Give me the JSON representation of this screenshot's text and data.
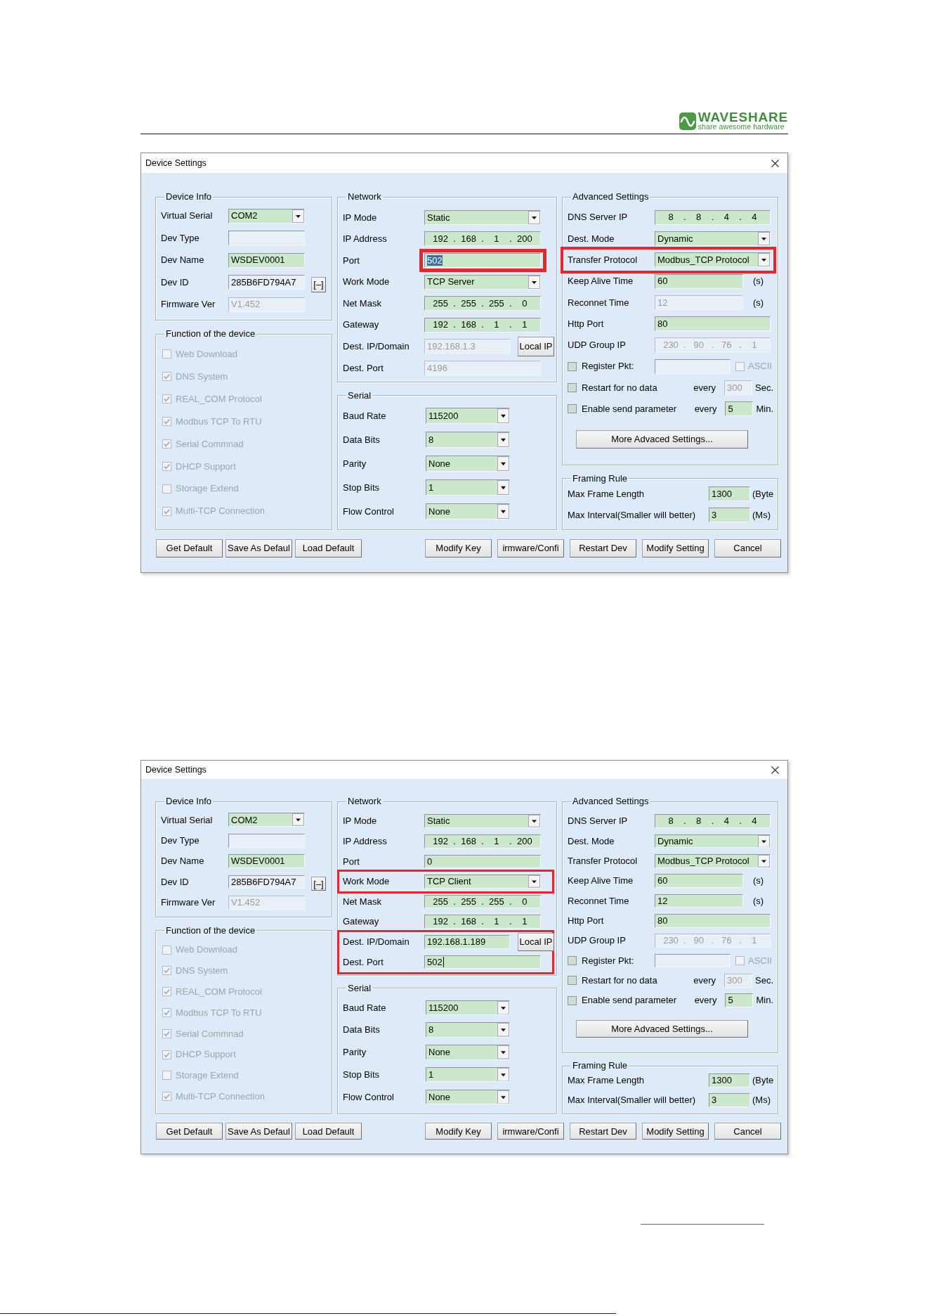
{
  "header": {
    "logo": {
      "name": "WAVESHARE",
      "tagline": "share awesome hardware"
    }
  },
  "dialogs": [
    {
      "title": "Device Settings",
      "columns": [
        {
          "groups": [
            {
              "title": "Device Info",
              "rows": [
                {
                  "kind": "field",
                  "label": "Virtual Serial",
                  "field": {
                    "kind": "combo",
                    "value": "COM2",
                    "editable": true,
                    "disabled": false
                  }
                },
                {
                  "kind": "field",
                  "label": "Dev Type",
                  "field": {
                    "kind": "text",
                    "editable": false,
                    "disabled": false
                  }
                },
                {
                  "kind": "field",
                  "label": "Dev Name",
                  "field": {
                    "kind": "text",
                    "value": "WSDEV0001",
                    "editable": true,
                    "disabled": false
                  }
                },
                {
                  "kind": "field",
                  "label": "Dev ID",
                  "field": {
                    "kind": "text",
                    "value": "285B6FD794A7",
                    "editable": false,
                    "disabled": false
                  },
                  "button": "[–]"
                },
                {
                  "kind": "field",
                  "label": "Firmware Ver",
                  "field": {
                    "kind": "text",
                    "value": "V1.452",
                    "editable": false,
                    "disabled": true
                  }
                }
              ]
            },
            {
              "title": "Function of the device",
              "rows": [
                {
                  "kind": "checkbox",
                  "label": "Web Download",
                  "checked": false,
                  "disabled": true
                },
                {
                  "kind": "checkbox",
                  "label": "DNS System",
                  "checked": true,
                  "disabled": true
                },
                {
                  "kind": "checkbox",
                  "label": "REAL_COM Protocol",
                  "checked": true,
                  "disabled": true
                },
                {
                  "kind": "checkbox",
                  "label": "Modbus TCP To RTU",
                  "checked": true,
                  "disabled": true
                },
                {
                  "kind": "checkbox",
                  "label": "Serial Commnad",
                  "checked": true,
                  "disabled": true
                },
                {
                  "kind": "checkbox",
                  "label": "DHCP Support",
                  "checked": true,
                  "disabled": true
                },
                {
                  "kind": "checkbox",
                  "label": "Storage Extend",
                  "checked": false,
                  "disabled": true
                },
                {
                  "kind": "checkbox",
                  "label": "Multi-TCP Connection",
                  "checked": true,
                  "disabled": true
                }
              ]
            }
          ]
        },
        {
          "groups": [
            {
              "title": "Network",
              "rows": [
                {
                  "kind": "field",
                  "label": "IP Mode",
                  "field": {
                    "kind": "combo",
                    "value": "Static",
                    "editable": true,
                    "disabled": false
                  }
                },
                {
                  "kind": "field",
                  "label": "IP Address",
                  "field": {
                    "kind": "ip",
                    "value": "192 . 168 . 1 . 200",
                    "editable": true,
                    "disabled": false
                  }
                },
                {
                  "kind": "field",
                  "label": "Port",
                  "field": {
                    "kind": "text",
                    "value": "502",
                    "editable": true,
                    "disabled": false,
                    "text_selected": true,
                    "highlighted": true
                  }
                },
                {
                  "kind": "field",
                  "label": "Work Mode",
                  "field": {
                    "kind": "combo",
                    "value": "TCP Server",
                    "editable": true,
                    "disabled": false
                  }
                },
                {
                  "kind": "field",
                  "label": "Net Mask",
                  "field": {
                    "kind": "ip",
                    "value": "255 . 255 . 255 . 0",
                    "editable": true,
                    "disabled": false
                  }
                },
                {
                  "kind": "field",
                  "label": "Gateway",
                  "field": {
                    "kind": "ip",
                    "value": "192 . 168 . 1 . 1",
                    "editable": true,
                    "disabled": false
                  }
                },
                {
                  "kind": "field",
                  "label": "Dest. IP/Domain",
                  "field": {
                    "kind": "text",
                    "value": "192.168.1.3",
                    "editable": false,
                    "disabled": true
                  },
                  "button": "Local IP"
                },
                {
                  "kind": "field",
                  "label": "Dest. Port",
                  "field": {
                    "kind": "text",
                    "value": "4196",
                    "editable": false,
                    "disabled": true
                  }
                }
              ]
            },
            {
              "title": "Serial",
              "rows": [
                {
                  "kind": "field",
                  "label": "Baud Rate",
                  "field": {
                    "kind": "combo",
                    "value": "115200",
                    "editable": true,
                    "disabled": false
                  }
                },
                {
                  "kind": "field",
                  "label": "Data Bits",
                  "field": {
                    "kind": "combo",
                    "value": "8",
                    "editable": true,
                    "disabled": false
                  }
                },
                {
                  "kind": "field",
                  "label": "Parity",
                  "field": {
                    "kind": "combo",
                    "value": "None",
                    "editable": true,
                    "disabled": false
                  }
                },
                {
                  "kind": "field",
                  "label": "Stop Bits",
                  "field": {
                    "kind": "combo",
                    "value": "1",
                    "editable": true,
                    "disabled": false
                  }
                },
                {
                  "kind": "field",
                  "label": "Flow Control",
                  "field": {
                    "kind": "combo",
                    "value": "None",
                    "editable": true,
                    "disabled": false
                  }
                }
              ]
            }
          ]
        },
        {
          "groups": [
            {
              "title": "Advanced Settings",
              "rows": [
                {
                  "kind": "field",
                  "label": "DNS Server IP",
                  "field": {
                    "kind": "ip",
                    "value": "8 . 8 . 4 . 4",
                    "editable": true,
                    "disabled": false
                  }
                },
                {
                  "kind": "field",
                  "label": "Dest. Mode",
                  "field": {
                    "kind": "combo",
                    "value": "Dynamic",
                    "editable": true,
                    "disabled": false
                  }
                },
                {
                  "kind": "field",
                  "label": "Transfer Protocol",
                  "field": {
                    "kind": "combo",
                    "value": "Modbus_TCP Protocol",
                    "editable": true,
                    "disabled": false
                  },
                  "highlighted": true
                },
                {
                  "kind": "field",
                  "label": "Keep Alive Time",
                  "field": {
                    "kind": "text",
                    "value": "60",
                    "editable": true,
                    "disabled": false
                  },
                  "unit": "(s)"
                },
                {
                  "kind": "field",
                  "label": "Reconnet Time",
                  "field": {
                    "kind": "text",
                    "value": "12",
                    "editable": false,
                    "disabled": true
                  },
                  "unit": "(s)"
                },
                {
                  "kind": "field",
                  "label": "Http Port",
                  "field": {
                    "kind": "text",
                    "value": "80",
                    "editable": true,
                    "disabled": false
                  }
                },
                {
                  "kind": "field",
                  "label": "UDP Group IP",
                  "field": {
                    "kind": "ip",
                    "value": "230 . 90 . 76 . 1",
                    "editable": false,
                    "disabled": true
                  }
                },
                {
                  "kind": "check_field",
                  "label": "Register Pkt:",
                  "checked": false,
                  "disabled": false,
                  "field": {
                    "kind": "text",
                    "editable": false,
                    "disabled": false
                  },
                  "option": {
                    "label": "ASCII",
                    "checked": false,
                    "disabled": true
                  }
                },
                {
                  "kind": "check_field",
                  "label": "Restart for no data",
                  "checked": false,
                  "disabled": false,
                  "prefix": "every",
                  "field": {
                    "kind": "text",
                    "value": "300",
                    "editable": false,
                    "disabled": true
                  },
                  "unit": "Sec."
                },
                {
                  "kind": "check_field",
                  "label": "Enable send parameter",
                  "checked": false,
                  "disabled": false,
                  "prefix": "every",
                  "field": {
                    "kind": "text",
                    "value": "5",
                    "editable": true,
                    "disabled": false
                  },
                  "unit": "Min."
                },
                {
                  "kind": "button",
                  "label": "More Advaced Settings..."
                }
              ]
            },
            {
              "title": "Framing Rule",
              "rows": [
                {
                  "kind": "field",
                  "label": "Max Frame Length",
                  "field": {
                    "kind": "text",
                    "value": "1300",
                    "editable": true,
                    "disabled": false
                  },
                  "unit": "(Byte"
                },
                {
                  "kind": "field",
                  "label": "Max Interval(Smaller will better)",
                  "field": {
                    "kind": "text",
                    "value": "3",
                    "editable": true,
                    "disabled": false
                  },
                  "unit": "(Ms)"
                }
              ]
            }
          ]
        }
      ],
      "button_groups": [
        [
          "Get Default",
          "Save As Defaul",
          "Load Default"
        ],
        [
          "Modify Key",
          "irmware/Confi",
          "Restart Dev",
          "Modify Setting",
          "Cancel"
        ]
      ]
    },
    {
      "title": "Device Settings",
      "columns": [
        {
          "groups": [
            {
              "title": "Device Info",
              "rows": [
                {
                  "kind": "field",
                  "label": "Virtual Serial",
                  "field": {
                    "kind": "combo",
                    "value": "COM2",
                    "editable": true,
                    "disabled": false
                  }
                },
                {
                  "kind": "field",
                  "label": "Dev Type",
                  "field": {
                    "kind": "text",
                    "editable": false,
                    "disabled": false
                  }
                },
                {
                  "kind": "field",
                  "label": "Dev Name",
                  "field": {
                    "kind": "text",
                    "value": "WSDEV0001",
                    "editable": true,
                    "disabled": false
                  }
                },
                {
                  "kind": "field",
                  "label": "Dev ID",
                  "field": {
                    "kind": "text",
                    "value": "285B6FD794A7",
                    "editable": false,
                    "disabled": false
                  },
                  "button": "[–]"
                },
                {
                  "kind": "field",
                  "label": "Firmware Ver",
                  "field": {
                    "kind": "text",
                    "value": "V1.452",
                    "editable": false,
                    "disabled": true
                  }
                }
              ]
            },
            {
              "title": "Function of the device",
              "rows": [
                {
                  "kind": "checkbox",
                  "label": "Web Download",
                  "checked": false,
                  "disabled": true
                },
                {
                  "kind": "checkbox",
                  "label": "DNS System",
                  "checked": true,
                  "disabled": true
                },
                {
                  "kind": "checkbox",
                  "label": "REAL_COM Protocol",
                  "checked": true,
                  "disabled": true
                },
                {
                  "kind": "checkbox",
                  "label": "Modbus TCP To RTU",
                  "checked": true,
                  "disabled": true
                },
                {
                  "kind": "checkbox",
                  "label": "Serial Commnad",
                  "checked": true,
                  "disabled": true
                },
                {
                  "kind": "checkbox",
                  "label": "DHCP Support",
                  "checked": true,
                  "disabled": true
                },
                {
                  "kind": "checkbox",
                  "label": "Storage Extend",
                  "checked": false,
                  "disabled": true
                },
                {
                  "kind": "checkbox",
                  "label": "Multi-TCP Connection",
                  "checked": true,
                  "disabled": true
                }
              ]
            }
          ]
        },
        {
          "groups": [
            {
              "title": "Network",
              "rows": [
                {
                  "kind": "field",
                  "label": "IP Mode",
                  "field": {
                    "kind": "combo",
                    "value": "Static",
                    "editable": true,
                    "disabled": false
                  }
                },
                {
                  "kind": "field",
                  "label": "IP Address",
                  "field": {
                    "kind": "ip",
                    "value": "192 . 168 . 1 . 200",
                    "editable": true,
                    "disabled": false
                  }
                },
                {
                  "kind": "field",
                  "label": "Port",
                  "field": {
                    "kind": "text",
                    "value": "0",
                    "editable": true,
                    "disabled": false
                  }
                },
                {
                  "kind": "field",
                  "label": "Work Mode",
                  "field": {
                    "kind": "combo",
                    "value": "TCP Client",
                    "editable": true,
                    "disabled": false
                  },
                  "highlighted": true
                },
                {
                  "kind": "field",
                  "label": "Net Mask",
                  "field": {
                    "kind": "ip",
                    "value": "255 . 255 . 255 . 0",
                    "editable": true,
                    "disabled": false
                  }
                },
                {
                  "kind": "field",
                  "label": "Gateway",
                  "field": {
                    "kind": "ip",
                    "value": "192 . 168 . 1 . 1",
                    "editable": true,
                    "disabled": false
                  }
                },
                {
                  "kind": "field",
                  "label": "Dest. IP/Domain",
                  "field": {
                    "kind": "text",
                    "value": "192.168.1.189",
                    "editable": true,
                    "disabled": false
                  },
                  "button": "Local IP",
                  "highlighted": true
                },
                {
                  "kind": "field",
                  "label": "Dest. Port",
                  "field": {
                    "kind": "text",
                    "value": "502",
                    "editable": true,
                    "disabled": false,
                    "caret": true
                  },
                  "highlighted": true
                }
              ]
            },
            {
              "title": "Serial",
              "rows": [
                {
                  "kind": "field",
                  "label": "Baud Rate",
                  "field": {
                    "kind": "combo",
                    "value": "115200",
                    "editable": true,
                    "disabled": false
                  }
                },
                {
                  "kind": "field",
                  "label": "Data Bits",
                  "field": {
                    "kind": "combo",
                    "value": "8",
                    "editable": true,
                    "disabled": false
                  }
                },
                {
                  "kind": "field",
                  "label": "Parity",
                  "field": {
                    "kind": "combo",
                    "value": "None",
                    "editable": true,
                    "disabled": false
                  }
                },
                {
                  "kind": "field",
                  "label": "Stop Bits",
                  "field": {
                    "kind": "combo",
                    "value": "1",
                    "editable": true,
                    "disabled": false
                  }
                },
                {
                  "kind": "field",
                  "label": "Flow Control",
                  "field": {
                    "kind": "combo",
                    "value": "None",
                    "editable": true,
                    "disabled": false
                  }
                }
              ]
            }
          ]
        },
        {
          "groups": [
            {
              "title": "Advanced Settings",
              "rows": [
                {
                  "kind": "field",
                  "label": "DNS Server IP",
                  "field": {
                    "kind": "ip",
                    "value": "8 . 8 . 4 . 4",
                    "editable": true,
                    "disabled": false
                  }
                },
                {
                  "kind": "field",
                  "label": "Dest. Mode",
                  "field": {
                    "kind": "combo",
                    "value": "Dynamic",
                    "editable": true,
                    "disabled": false
                  }
                },
                {
                  "kind": "field",
                  "label": "Transfer Protocol",
                  "field": {
                    "kind": "combo",
                    "value": "Modbus_TCP Protocol",
                    "editable": true,
                    "disabled": false
                  }
                },
                {
                  "kind": "field",
                  "label": "Keep Alive Time",
                  "field": {
                    "kind": "text",
                    "value": "60",
                    "editable": true,
                    "disabled": false
                  },
                  "unit": "(s)"
                },
                {
                  "kind": "field",
                  "label": "Reconnet Time",
                  "field": {
                    "kind": "text",
                    "value": "12",
                    "editable": true,
                    "disabled": false
                  },
                  "unit": "(s)"
                },
                {
                  "kind": "field",
                  "label": "Http Port",
                  "field": {
                    "kind": "text",
                    "value": "80",
                    "editable": true,
                    "disabled": false
                  }
                },
                {
                  "kind": "field",
                  "label": "UDP Group IP",
                  "field": {
                    "kind": "ip",
                    "value": "230 . 90 . 76 . 1",
                    "editable": false,
                    "disabled": true
                  }
                },
                {
                  "kind": "check_field",
                  "label": "Register Pkt:",
                  "checked": false,
                  "disabled": false,
                  "field": {
                    "kind": "text",
                    "editable": false,
                    "disabled": false
                  },
                  "option": {
                    "label": "ASCII",
                    "checked": false,
                    "disabled": true
                  }
                },
                {
                  "kind": "check_field",
                  "label": "Restart for no data",
                  "checked": false,
                  "disabled": false,
                  "prefix": "every",
                  "field": {
                    "kind": "text",
                    "value": "300",
                    "editable": false,
                    "disabled": true
                  },
                  "unit": "Sec."
                },
                {
                  "kind": "check_field",
                  "label": "Enable send parameter",
                  "checked": false,
                  "disabled": false,
                  "prefix": "every",
                  "field": {
                    "kind": "text",
                    "value": "5",
                    "editable": true,
                    "disabled": false
                  },
                  "unit": "Min."
                },
                {
                  "kind": "button",
                  "label": "More Advaced Settings..."
                }
              ]
            },
            {
              "title": "Framing Rule",
              "rows": [
                {
                  "kind": "field",
                  "label": "Max Frame Length",
                  "field": {
                    "kind": "text",
                    "value": "1300",
                    "editable": true,
                    "disabled": false
                  },
                  "unit": "(Byte"
                },
                {
                  "kind": "field",
                  "label": "Max Interval(Smaller will better)",
                  "field": {
                    "kind": "text",
                    "value": "3",
                    "editable": true,
                    "disabled": false
                  },
                  "unit": "(Ms)"
                }
              ]
            }
          ]
        }
      ],
      "button_groups": [
        [
          "Get Default",
          "Save As Defaul",
          "Load Default"
        ],
        [
          "Modify Key",
          "irmware/Confi",
          "Restart Dev",
          "Modify Setting",
          "Cancel"
        ]
      ]
    }
  ]
}
